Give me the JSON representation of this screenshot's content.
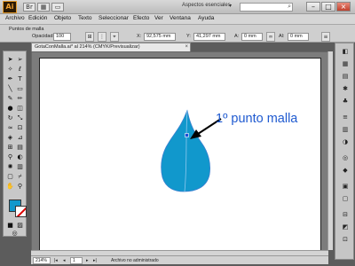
{
  "titlebar": {
    "logo": "Ai",
    "workspace": "Aspectos esenciales",
    "workspace_dropdown": "▾"
  },
  "menu": {
    "items": [
      "Archivo",
      "Edición",
      "Objeto",
      "Texto",
      "Seleccionar",
      "Efecto",
      "Ver",
      "Ventana",
      "Ayuda"
    ]
  },
  "controlbar": {
    "object_label": "Puntos de malla",
    "opacity_label": "Opacidad:",
    "opacity_value": "100",
    "x_label": "X:",
    "x_value": "92,575 mm",
    "y_label": "Y:",
    "y_value": "41,297 mm",
    "a_label": "A:",
    "a_value": "0 mm",
    "al_label": "Al:",
    "al_value": "0 mm"
  },
  "document": {
    "tab_title": "GotaConMalla.ai* al 214% (CMYK/Previsualizar)",
    "annotation": "1º punto malla",
    "fill_color": "#1198cc"
  },
  "statusbar": {
    "zoom": "214%",
    "page": "1",
    "status": "Archivo no administrado"
  },
  "icons": {
    "close": "×",
    "search": "⌕"
  }
}
